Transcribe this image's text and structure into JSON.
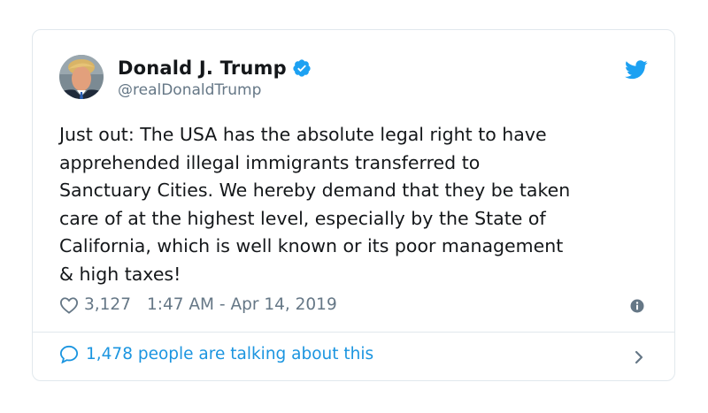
{
  "tweet": {
    "author_name": "Donald J. Trump",
    "author_handle": "@realDonaldTrump",
    "text": "Just out: The USA has the absolute legal right to have\napprehended illegal immigrants transferred to\nSanctuary Cities. We hereby demand that they be taken\ncare of at the highest level, especially by the State of\nCalifornia, which is well known or its poor management\n& high taxes!",
    "likes": "3,127",
    "timestamp": "1:47 AM - Apr 14, 2019",
    "talking_about": "1,478 people are talking about this"
  },
  "icons": {
    "verified": "verified-badge-icon",
    "bird": "twitter-bird-icon",
    "heart": "heart-icon",
    "info": "info-icon",
    "bubble": "speech-bubble-icon",
    "chevron": "chevron-right-icon"
  },
  "colors": {
    "brand_blue": "#1da1f2",
    "link_blue": "#1b95e0",
    "muted_gray": "#657786",
    "border": "#e1e8ed"
  }
}
